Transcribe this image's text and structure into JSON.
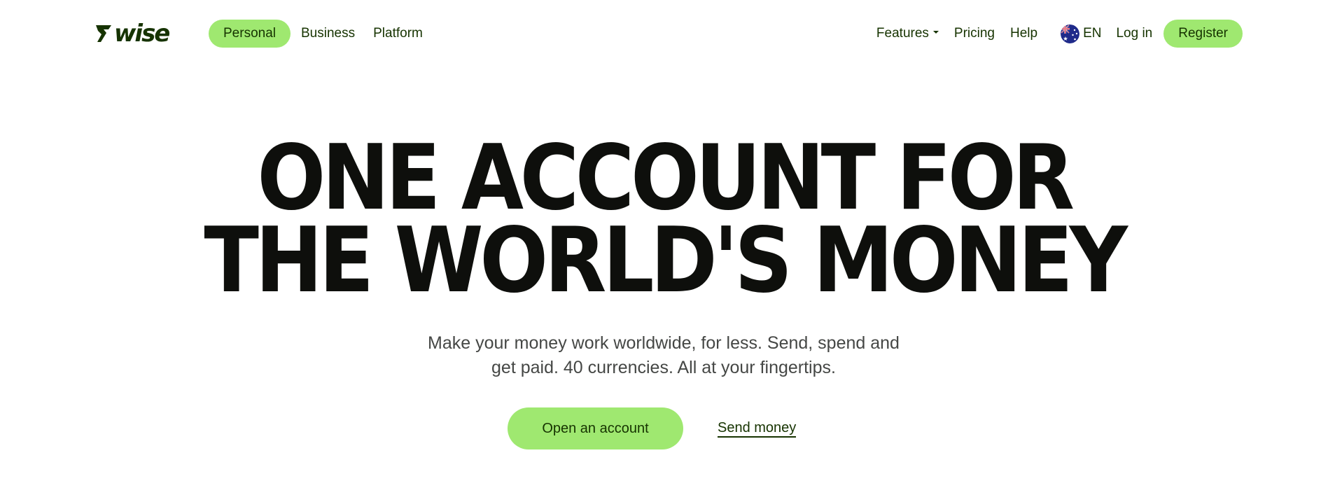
{
  "brand": {
    "logo_text": "wise",
    "accent_color": "#9fe870",
    "text_color": "#163300"
  },
  "nav": {
    "left_items": [
      {
        "label": "Personal",
        "active": true
      },
      {
        "label": "Business",
        "active": false
      },
      {
        "label": "Platform",
        "active": false
      }
    ],
    "features_label": "Features",
    "pricing_label": "Pricing",
    "help_label": "Help",
    "language": {
      "code": "EN",
      "flag_icon": "australia-flag-icon"
    },
    "login_label": "Log in",
    "register_label": "Register"
  },
  "hero": {
    "title_line1": "ONE ACCOUNT FOR",
    "title_line2": "THE WORLD'S MONEY",
    "subtitle_line1": "Make your money work worldwide, for less. Send, spend and",
    "subtitle_line2": "get paid. 40 currencies. All at your fingertips.",
    "primary_cta": "Open an account",
    "secondary_cta": "Send money"
  }
}
